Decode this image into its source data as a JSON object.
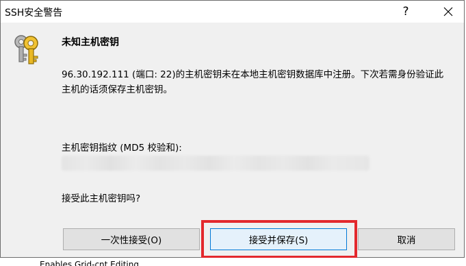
{
  "window": {
    "title": "SSH安全警告",
    "help_label": "?",
    "close_icon": "close-icon"
  },
  "content": {
    "icon": "key-icon",
    "heading": "未知主机密钥",
    "message": "96.30.192.111 (端口: 22)的主机密钥未在本地主机密钥数据库中注册。下次若需身份验证此主机的话须保存主机密钥。",
    "fingerprint_label": "主机密钥指纹 (MD5 校验和):",
    "fingerprint_value": "",
    "question": "接受此主机密钥吗?"
  },
  "buttons": {
    "accept_once": "一次性接受(O)",
    "accept_save": "接受并保存(S)",
    "cancel": "取消"
  },
  "colors": {
    "highlight": "#e3282d",
    "default_button_border": "#0078d7"
  },
  "background_fragment": "Enables Grid-cnt Editing"
}
